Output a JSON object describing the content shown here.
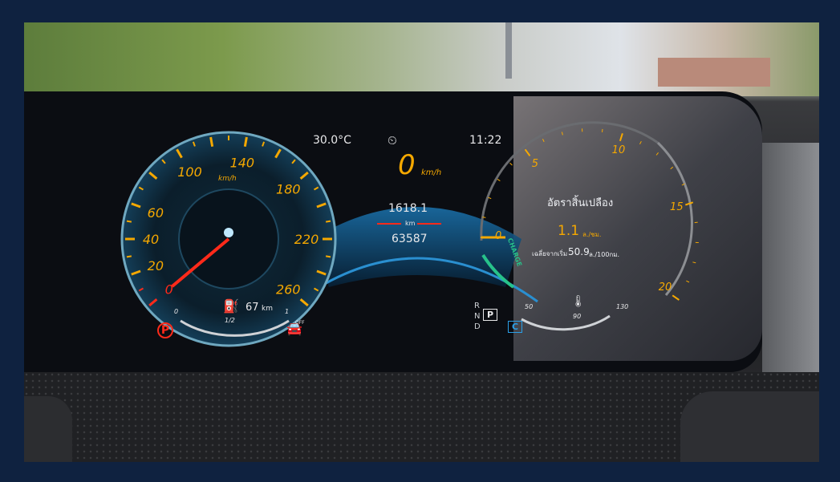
{
  "instrument_cluster": {
    "temperature": "30.0°C",
    "clock": "11:22",
    "speed": "0",
    "speed_unit": "km/h",
    "trip_km": "1618.1",
    "km_unit": "km",
    "odometer": "63587",
    "fuel_range_value": "67",
    "fuel_range_unit": "km",
    "fuel_half": "1/2",
    "fuel_empty": "0",
    "fuel_full": "1",
    "assist_off": "OFF",
    "gears": [
      "R",
      "N",
      "D"
    ],
    "gear_selected": "P",
    "drive_mode": "C"
  },
  "speedometer": {
    "unit": "km/h",
    "ticks": [
      "0",
      "20",
      "40",
      "60",
      "100",
      "140",
      "180",
      "220",
      "260"
    ],
    "needle_value": 0
  },
  "consumption_gauge": {
    "title": "อัตราสิ้นเปลือง",
    "ticks": [
      "0",
      "5",
      "10",
      "15",
      "20"
    ],
    "charge_label": "CHARGE",
    "current_value": "1.1",
    "current_unit": "ล./ชม.",
    "average_prefix": "เฉลี่ยจากเริ่ม",
    "average_value": "50.9",
    "average_unit": "ล./100กม.",
    "temp_low": "50",
    "temp_mid": "90",
    "temp_high": "130"
  },
  "colors": {
    "gauge_numbers": "#f5a800",
    "needle": "#ff2a1a",
    "accent_blue": "#2aa0e8",
    "charge_green": "#27c28a",
    "frame": "#0f2240"
  },
  "icons": [
    "thermometer-coolant-icon",
    "fuel-pump-icon",
    "parking-brake-icon",
    "traction-off-icon",
    "speed-limiter-icon"
  ]
}
